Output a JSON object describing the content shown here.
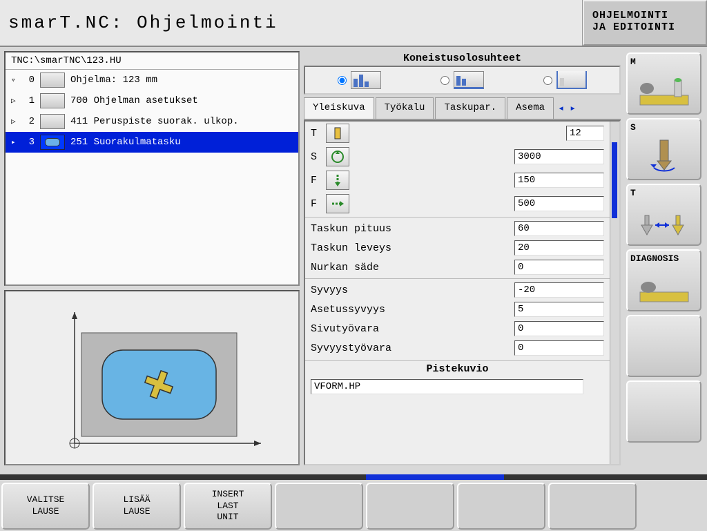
{
  "header": {
    "title": "smarT.NC: Ohjelmointi",
    "mode": "OHJELMOINTI\nJA EDITOINTI"
  },
  "path": "TNC:\\smarTNC\\123.HU",
  "tree": [
    {
      "arrow": "▿",
      "num": "0",
      "label": "Ohjelma: 123 mm",
      "sel": false
    },
    {
      "arrow": "▷",
      "num": "1",
      "label": "700 Ohjelman asetukset",
      "sel": false
    },
    {
      "arrow": "▷",
      "num": "2",
      "label": "411 Peruspiste suorak. ulkop.",
      "sel": false
    },
    {
      "arrow": "▸",
      "num": "3",
      "label": "251 Suorakulmatasku",
      "sel": true
    }
  ],
  "mid_title": "Koneistusolosuhteet",
  "tabs": [
    "Yleiskuva",
    "Työkalu",
    "Taskupar.",
    "Asema"
  ],
  "form": {
    "t_label": "T",
    "t_value": "12",
    "s_label": "S",
    "s_value": "3000",
    "f1_label": "F",
    "f1_value": "150",
    "f2_label": "F",
    "f2_value": "500",
    "len_label": "Taskun pituus",
    "len_value": "60",
    "wid_label": "Taskun leveys",
    "wid_value": "20",
    "rad_label": "Nurkan säde",
    "rad_value": "0",
    "depth_label": "Syvyys",
    "depth_value": "-20",
    "setdepth_label": "Asetussyvyys",
    "setdepth_value": "5",
    "side_label": "Sivutyövara",
    "side_value": "0",
    "depthall_label": "Syvyystyövara",
    "depthall_value": "0",
    "pattern_title": "Pistekuvio",
    "pattern_value": "VFORM.HP"
  },
  "side": {
    "m": "M",
    "s": "S",
    "t": "T",
    "diag": "DIAGNOSIS"
  },
  "softkeys": [
    "VALITSE\nLAUSE",
    "LISÄÄ\nLAUSE",
    "INSERT\nLAST\nUNIT",
    "",
    "",
    "",
    "",
    ""
  ]
}
